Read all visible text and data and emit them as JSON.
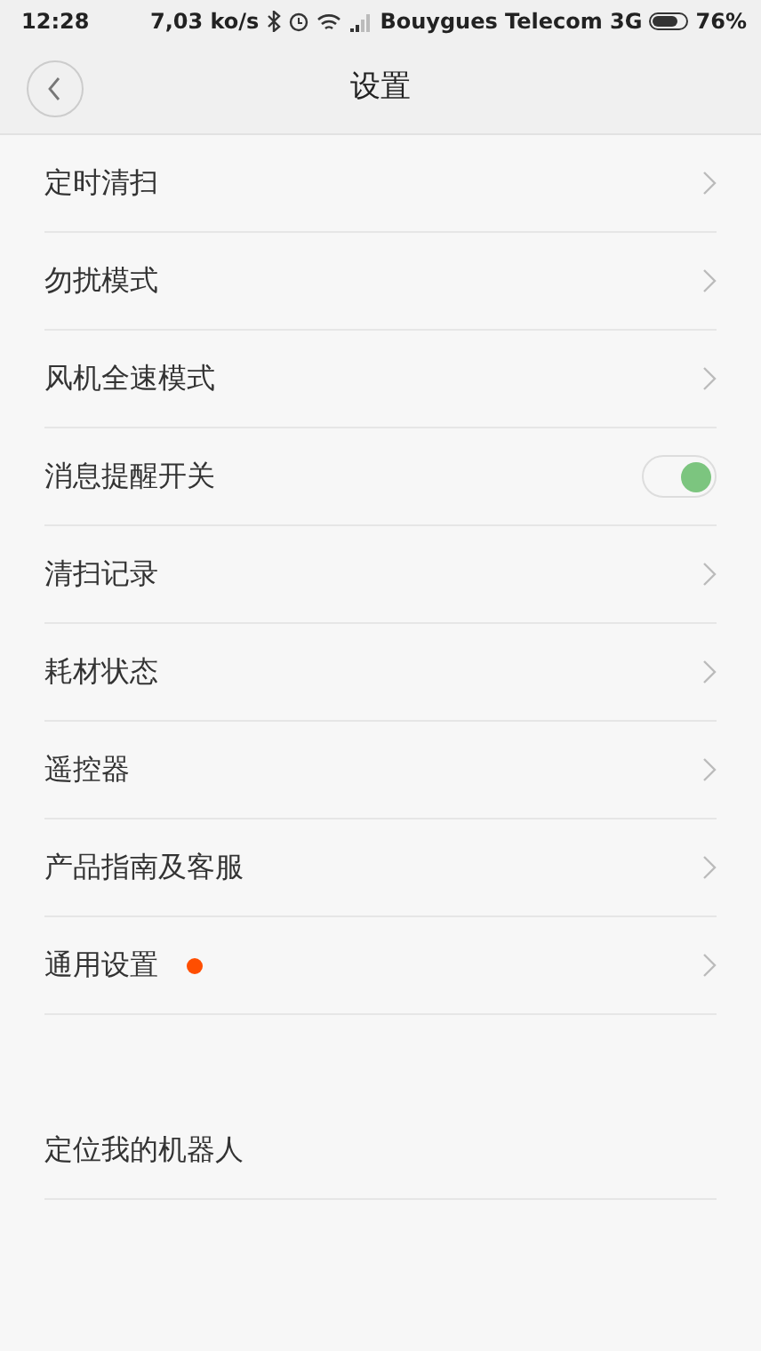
{
  "status_bar": {
    "time": "12:28",
    "speed": "7,03 ko/s",
    "carrier": "Bouygues Telecom 3G",
    "battery": "76%"
  },
  "header": {
    "title": "设置"
  },
  "sections": [
    {
      "items": [
        {
          "label": "定时清扫",
          "kind": "link",
          "dot": false
        },
        {
          "label": "勿扰模式",
          "kind": "link",
          "dot": false
        },
        {
          "label": "风机全速模式",
          "kind": "link",
          "dot": false
        },
        {
          "label": "消息提醒开关",
          "kind": "toggle",
          "on": true,
          "dot": false
        },
        {
          "label": "清扫记录",
          "kind": "link",
          "dot": false
        },
        {
          "label": "耗材状态",
          "kind": "link",
          "dot": false
        },
        {
          "label": "遥控器",
          "kind": "link",
          "dot": false
        },
        {
          "label": "产品指南及客服",
          "kind": "link",
          "dot": false
        },
        {
          "label": "通用设置",
          "kind": "link",
          "dot": true
        }
      ]
    },
    {
      "items": [
        {
          "label": "定位我的机器人",
          "kind": "plain",
          "dot": false
        }
      ]
    }
  ]
}
